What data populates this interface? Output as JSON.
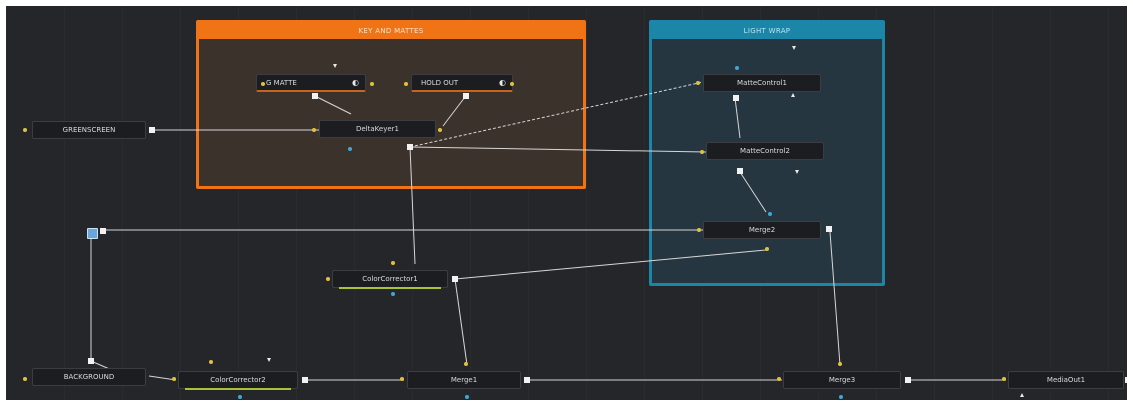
{
  "groups": {
    "key_mattes": {
      "title": "KEY AND MATTES",
      "color": "#f07415"
    },
    "light_wrap": {
      "title": "LIGHT WRAP",
      "color": "#1b86a7"
    }
  },
  "nodes": {
    "g_matte": {
      "label": "G MATTE"
    },
    "hold_out": {
      "label": "HOLD OUT"
    },
    "greenscreen": {
      "label": "GREENSCREEN"
    },
    "delta_keyer": {
      "label": "DeltaKeyer1"
    },
    "matte_control1": {
      "label": "MatteControl1"
    },
    "matte_control2": {
      "label": "MatteControl2"
    },
    "merge2": {
      "label": "Merge2"
    },
    "color_corrector1": {
      "label": "ColorCorrector1"
    },
    "background": {
      "label": "BACKGROUND"
    },
    "color_corrector2": {
      "label": "ColorCorrector2"
    },
    "merge1": {
      "label": "Merge1"
    },
    "merge3": {
      "label": "Merge3"
    },
    "media_out": {
      "label": "MediaOut1"
    }
  },
  "colors": {
    "canvas": "#25262a",
    "wire": "#d7d7d7",
    "input_port": "#e0c23a",
    "mask_port": "#3fa7d6",
    "active_underline": "#a8c23a"
  },
  "icons": {
    "mask_tool": "half-circle-icon",
    "pipe_router": "square-router-icon"
  }
}
